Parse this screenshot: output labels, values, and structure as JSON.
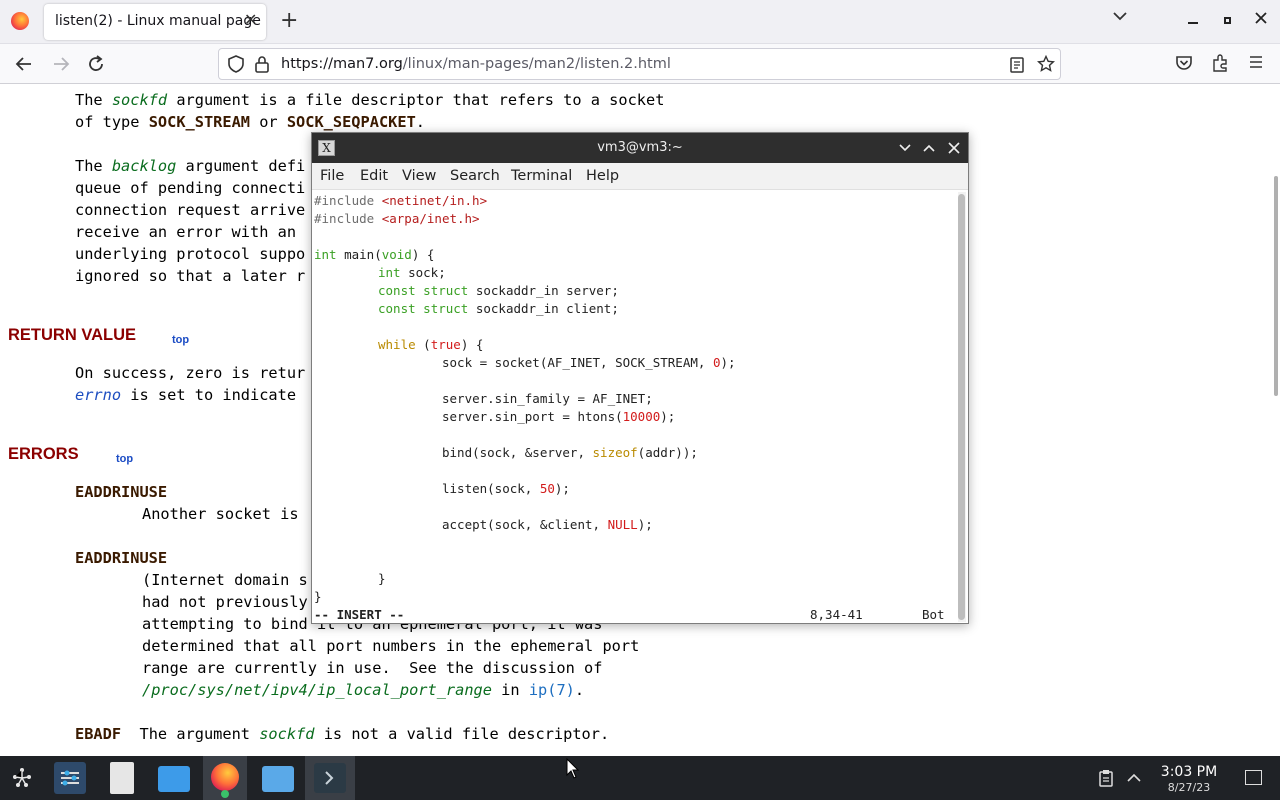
{
  "browser": {
    "tab_title": "listen(2) - Linux manual page",
    "tab_close": "✕",
    "new_tab": "+",
    "url_domain": "https://man7.org",
    "url_path": "/linux/man-pages/man2/listen.2.html"
  },
  "man": {
    "line1": "The ",
    "line1_arg": "sockfd",
    "line1_rest": " argument is a file descriptor that refers to a socket",
    "line2": "of type ",
    "line2_b1": "SOCK_STREAM",
    "line2_mid": " or ",
    "line2_b2": "SOCK_SEQPACKET",
    "line2_end": ".",
    "line3": "The ",
    "line3_arg": "backlog",
    "line3_rest": " argument defi",
    "line4": "queue of pending connecti",
    "line5": "connection request arrive",
    "line6": "receive an error with an",
    "line7": "underlying protocol suppo",
    "line8": "ignored so that a later r",
    "return_heading": "RETURN VALUE",
    "top_label": "top",
    "return_line1": "On success, zero is retur",
    "return_line2_var": "errno",
    "return_line2_rest": " is set to indicate",
    "errors_heading": "ERRORS",
    "err1_name": "EADDRINUSE",
    "err1_desc": "Another socket is",
    "err2_name": "EADDRINUSE",
    "err2_line1": "(Internet domain s",
    "err2_line2": "had not previously",
    "err2_line3": "attempting to bind it to an ephemeral port, it was",
    "err2_line4": "determined that all port numbers in the ephemeral port",
    "err2_line5": "range are currently in use.  See the discussion of",
    "err2_path": "/proc/sys/net/ipv4/ip_local_port_range",
    "err2_in": " in ",
    "err2_link": "ip(7)",
    "err2_end": ".",
    "err3_name": "EBADF",
    "err3_pre": "  The argument ",
    "err3_arg": "sockfd",
    "err3_rest": " is not a valid file descriptor."
  },
  "terminal": {
    "title": "vm3@vm3:~",
    "menu": [
      "File",
      "Edit",
      "View",
      "Search",
      "Terminal",
      "Help"
    ],
    "code": {
      "inc1_kw": "#include ",
      "inc1_file": "<netinet/in.h>",
      "inc2_kw": "#include ",
      "inc2_file": "<arpa/inet.h>",
      "main_type": "int",
      "main_rest": " main(",
      "main_void": "void",
      "main_end": ") {",
      "l_int": "int",
      "l_int_rest": " sock;",
      "l_const1": "const",
      "l_struct1": " struct",
      "l_server": " sockaddr_in server;",
      "l_const2": "const",
      "l_struct2": " struct",
      "l_client": " sockaddr_in client;",
      "while_kw": "while",
      "while_open": " (",
      "while_true": "true",
      "while_end": ") {",
      "socket_line": "sock = socket(AF_INET, SOCK_STREAM, ",
      "socket_zero": "0",
      "socket_end": ");",
      "family_line": "server.sin_family = AF_INET;",
      "port_line": "server.sin_port = htons(",
      "port_num": "10000",
      "port_end": ");",
      "bind_line": "bind(sock, &server, ",
      "bind_sizeof": "sizeof",
      "bind_end": "(addr));",
      "listen_line": "listen(sock, ",
      "listen_num": "50",
      "listen_end": ");",
      "accept_line": "accept(sock, &client, ",
      "accept_null": "NULL",
      "accept_end": ");",
      "close_inner": "}",
      "close_outer": "}"
    },
    "status_mode": "-- INSERT --",
    "status_pos": "8,34-41",
    "status_scroll": "Bot"
  },
  "taskbar": {
    "time": "3:03 PM",
    "date": "8/27/23"
  }
}
